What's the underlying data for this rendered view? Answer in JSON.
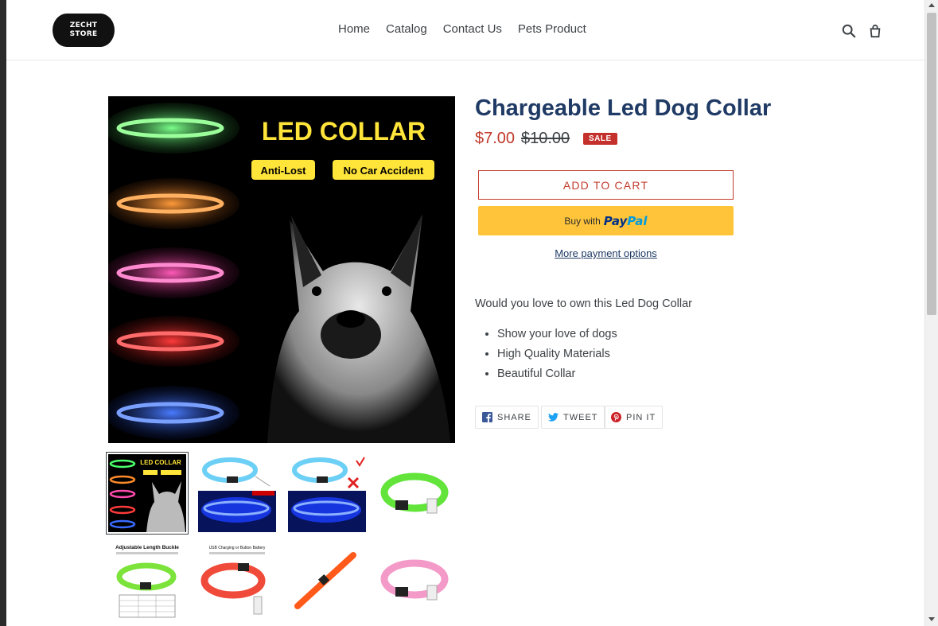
{
  "header": {
    "logo_line1": "ZECHT",
    "logo_line2": "STORE",
    "nav": [
      "Home",
      "Catalog",
      "Contact Us",
      "Pets Product"
    ],
    "search_icon": "search-icon",
    "cart_icon": "cart-icon"
  },
  "gallery": {
    "main_headline": "LED COLLAR",
    "main_tag1": "Anti-Lost",
    "main_tag2": "No Car Accident",
    "thumb5_caption": "Adjustable Length Buckle",
    "thumb6_caption": "USB Charging or Button Battery"
  },
  "product": {
    "title": "Chargeable Led Dog Collar",
    "sale_price": "$7.00",
    "regular_price": "$10.00",
    "sale_badge": "SALE",
    "add_to_cart": "ADD TO CART",
    "paypal_prefix": "Buy with",
    "paypal_brand1": "Pay",
    "paypal_brand2": "Pal",
    "more_payment": "More payment options",
    "description": "Would you love to own this Led Dog Collar",
    "bullets": [
      "Show your love of dogs",
      "High Quality Materials",
      "Beautiful Collar"
    ]
  },
  "share": {
    "facebook": "SHARE",
    "twitter": "TWEET",
    "pinterest": "PIN IT"
  },
  "colors": {
    "title": "#1f3a64",
    "sale": "#c0392b",
    "accent": "#c13d2c",
    "paypal": "#ffc439"
  }
}
